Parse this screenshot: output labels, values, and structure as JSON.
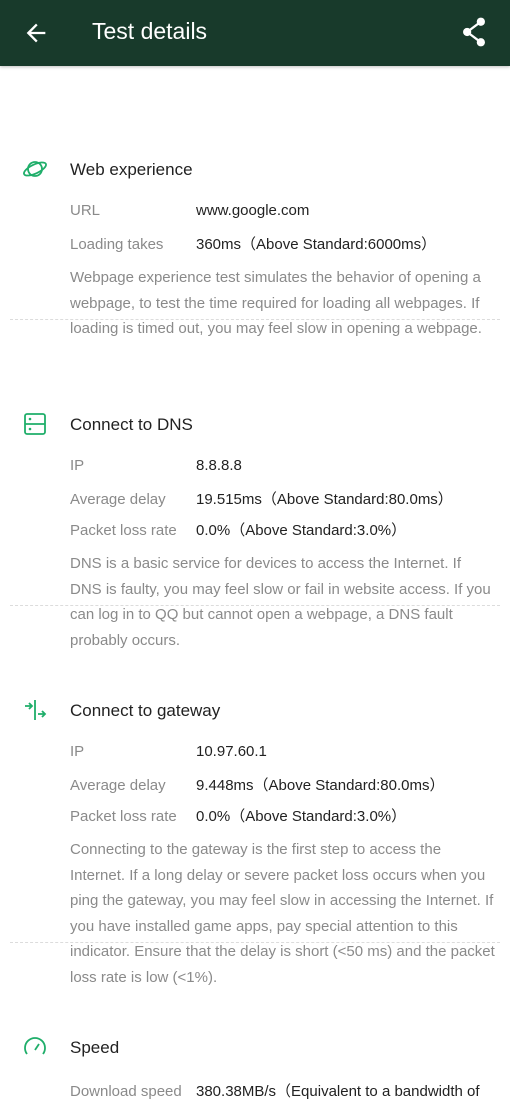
{
  "header": {
    "title": "Test details"
  },
  "web": {
    "title": "Web experience",
    "url_label": "URL",
    "url_value": "www.google.com",
    "loading_label": "Loading takes",
    "loading_value": "360ms（Above Standard:6000ms）",
    "desc": "Webpage experience test simulates the behavior of opening a webpage, to test the time required for loading all webpages. If loading is timed out, you may feel slow in opening a webpage."
  },
  "dns": {
    "title": "Connect to DNS",
    "ip_label": "IP",
    "ip_value": "8.8.8.8",
    "delay_label": "Average delay",
    "delay_value": "19.515ms（Above Standard:80.0ms）",
    "loss_label": "Packet loss rate",
    "loss_value": "0.0%（Above Standard:3.0%）",
    "desc": "DNS is a basic service for devices to access the Internet. If DNS is faulty, you may feel slow or fail in website access. If you can log in to QQ but cannot open a webpage, a DNS fault probably occurs."
  },
  "gateway": {
    "title": "Connect to gateway",
    "ip_label": "IP",
    "ip_value": "10.97.60.1",
    "delay_label": "Average delay",
    "delay_value": "9.448ms（Above Standard:80.0ms）",
    "loss_label": "Packet loss rate",
    "loss_value": "0.0%（Above Standard:3.0%）",
    "desc": "Connecting to the gateway is the first step to access the Internet. If a long delay or severe packet loss occurs when you ping the gateway, you may feel slow in accessing the Internet. If you have installed game apps, pay special attention to this indicator. Ensure that the delay is short (<50 ms) and the packet loss rate is low (<1%)."
  },
  "speed": {
    "title": "Speed",
    "download_label": "Download speed",
    "download_value": "380.38MB/s（Equivalent to a bandwidth of"
  },
  "colors": {
    "header_bg": "#183a2b",
    "accent": "#1fae6a"
  },
  "icons": [
    "back-arrow-icon",
    "share-icon",
    "planet-icon",
    "server-icon",
    "gateway-icon",
    "speedometer-icon"
  ]
}
